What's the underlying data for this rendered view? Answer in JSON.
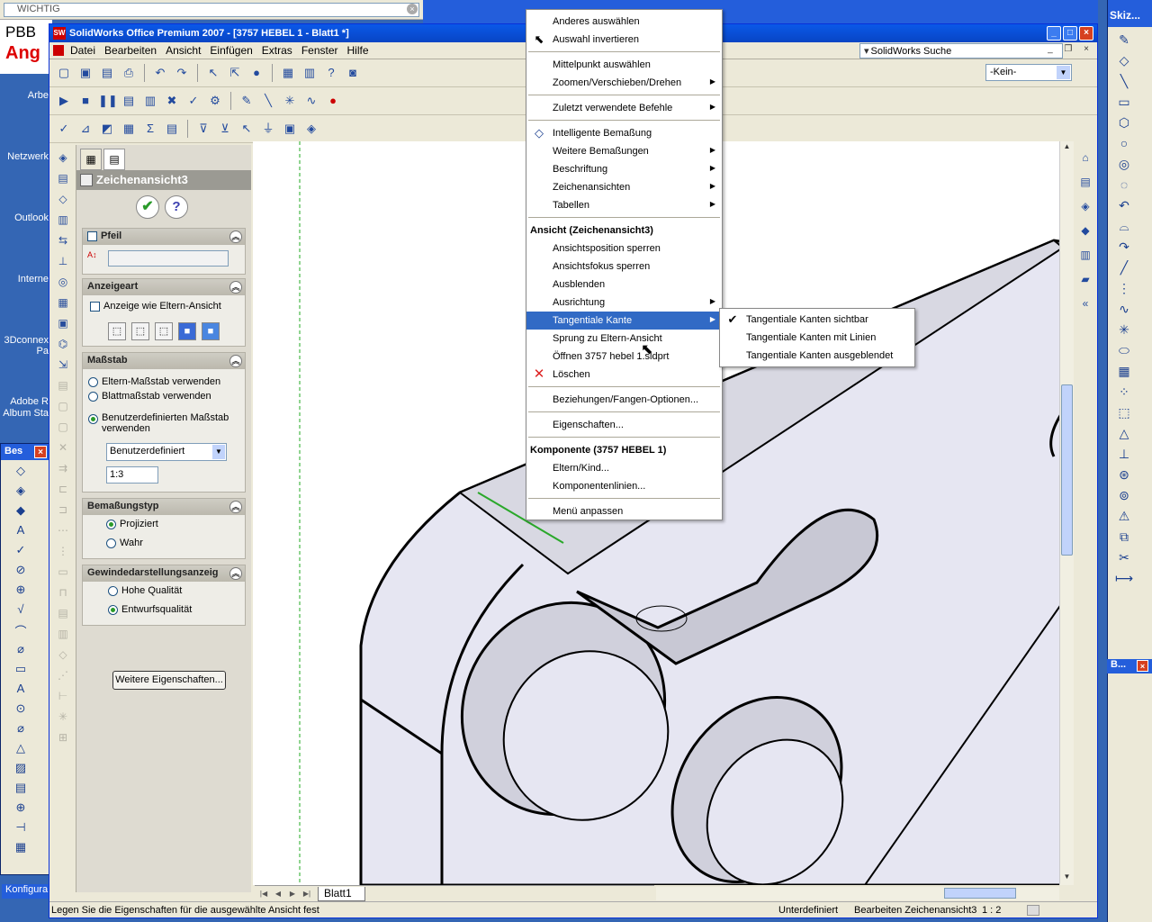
{
  "desktop": {
    "wichtig": "WICHTIG",
    "pbb_line1": "PBB",
    "pbb_line2": "Ang",
    "icons": [
      "Arbe",
      "Netzwerk",
      "Outlook",
      "Interne",
      "3Dconnex",
      "Pa",
      "Adobe R",
      "Album Sta"
    ],
    "left_toolbar_title": "Bes",
    "konfig": "Konfigura",
    "right_toolbar_title": "Skiz...",
    "right_toolbar2_title": "B..."
  },
  "window": {
    "title": "SolidWorks Office Premium 2007 - [3757 HEBEL 1 - Blatt1 *]",
    "menu": [
      "Datei",
      "Bearbeiten",
      "Ansicht",
      "Einfügen",
      "Extras",
      "Fenster",
      "Hilfe"
    ],
    "search_label": "SolidWorks Suche",
    "layer_combo": "-Kein-"
  },
  "property_manager": {
    "title": "Zeichenansicht3",
    "groups": {
      "pfeil": {
        "title": "Pfeil"
      },
      "anzeigeart": {
        "title": "Anzeigeart",
        "checkbox": "Anzeige wie Eltern-Ansicht"
      },
      "massstab": {
        "title": "Maßstab",
        "opt1": "Eltern-Maßstab verwenden",
        "opt2": "Blattmaßstab verwenden",
        "opt3": "Benutzerdefinierten Maßstab verwenden",
        "select_value": "Benutzerdefiniert",
        "scale_value": "1:3"
      },
      "bemassungstyp": {
        "title": "Bemaßungstyp",
        "opt1": "Projiziert",
        "opt2": "Wahr"
      },
      "gewinde": {
        "title": "Gewindedarstellungsanzeig",
        "opt1": "Hohe Qualität",
        "opt2": "Entwurfsqualität"
      }
    },
    "more_button": "Weitere Eigenschaften..."
  },
  "context_menu": {
    "items": [
      {
        "label": "Anderes auswählen",
        "sub": false
      },
      {
        "label": "Auswahl invertieren",
        "sub": false
      },
      {
        "label": "Mittelpunkt auswählen",
        "sub": false
      },
      {
        "label": "Zoomen/Verschieben/Drehen",
        "sub": true
      },
      {
        "label": "Zuletzt verwendete Befehle",
        "sub": true
      },
      {
        "label": "Intelligente Bemaßung",
        "sub": false
      },
      {
        "label": "Weitere Bemaßungen",
        "sub": true
      },
      {
        "label": "Beschriftung",
        "sub": true
      },
      {
        "label": "Zeichenansichten",
        "sub": true
      },
      {
        "label": "Tabellen",
        "sub": true
      },
      {
        "label": "Ansicht (Zeichenansicht3)",
        "header": true
      },
      {
        "label": "Ansichtsposition sperren"
      },
      {
        "label": "Ansichtsfokus sperren"
      },
      {
        "label": "Ausblenden"
      },
      {
        "label": "Ausrichtung",
        "sub": true
      },
      {
        "label": "Tangentiale Kante",
        "sub": true,
        "highlighted": true
      },
      {
        "label": "Sprung zu Eltern-Ansicht"
      },
      {
        "label": "Öffnen 3757 hebel 1.sldprt"
      },
      {
        "label": "Löschen"
      },
      {
        "label": "Beziehungen/Fangen-Optionen..."
      },
      {
        "label": "Eigenschaften..."
      },
      {
        "label": "Komponente (3757 HEBEL 1)",
        "header": true
      },
      {
        "label": "Eltern/Kind..."
      },
      {
        "label": "Komponentenlinien..."
      },
      {
        "label": "Menü anpassen"
      }
    ]
  },
  "submenu": {
    "items": [
      "Tangentiale Kanten sichtbar",
      "Tangentiale Kanten mit Linien",
      "Tangentiale Kanten ausgeblendet"
    ],
    "checked_index": 0
  },
  "sheet_tab": "Blatt1",
  "status": {
    "hint": "Legen Sie die Eigenschaften für die ausgewählte Ansicht fest",
    "state": "Unterdefiniert",
    "mode": "Bearbeiten Zeichenansicht3",
    "scale": "1 : 2"
  }
}
